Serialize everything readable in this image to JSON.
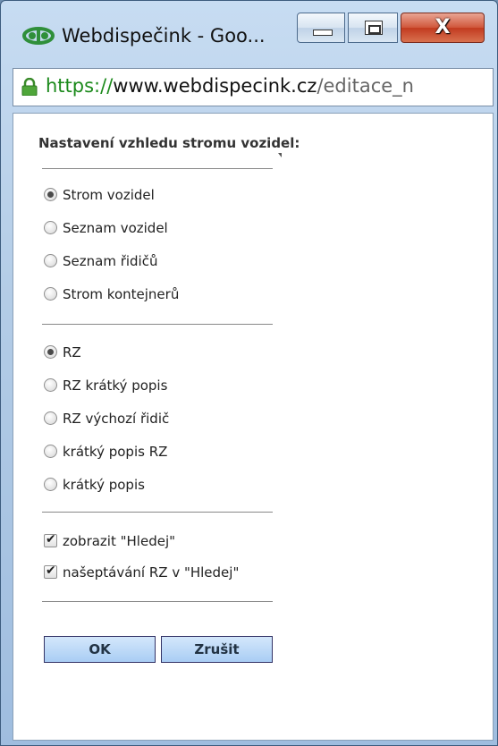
{
  "window": {
    "title": "Webdispečink - Goo...",
    "close_glyph": "X"
  },
  "address": {
    "scheme": "https://",
    "host": "www.webdispecink.cz",
    "path": "/editace_n"
  },
  "dialog": {
    "heading": "Nastavení vzhledu stromu vozidel:",
    "view_options": [
      {
        "label": "Strom vozidel",
        "selected": true
      },
      {
        "label": "Seznam vozidel",
        "selected": false
      },
      {
        "label": "Seznam řidičů",
        "selected": false
      },
      {
        "label": "Strom kontejnerů",
        "selected": false
      }
    ],
    "label_options": [
      {
        "label": "RZ",
        "selected": true
      },
      {
        "label": "RZ krátký popis",
        "selected": false
      },
      {
        "label": "RZ výchozí řidič",
        "selected": false
      },
      {
        "label": "krátký popis RZ",
        "selected": false
      },
      {
        "label": "krátký popis",
        "selected": false
      }
    ],
    "checkboxes": [
      {
        "label": "zobrazit \"Hledej\"",
        "checked": true
      },
      {
        "label": "našeptávání RZ v \"Hledej\"",
        "checked": true
      }
    ],
    "ok_label": "OK",
    "cancel_label": "Zrušit"
  },
  "colors": {
    "accent": "#a9cdf4",
    "secure_green": "#1c8a1c",
    "close_red": "#c23a1f"
  }
}
